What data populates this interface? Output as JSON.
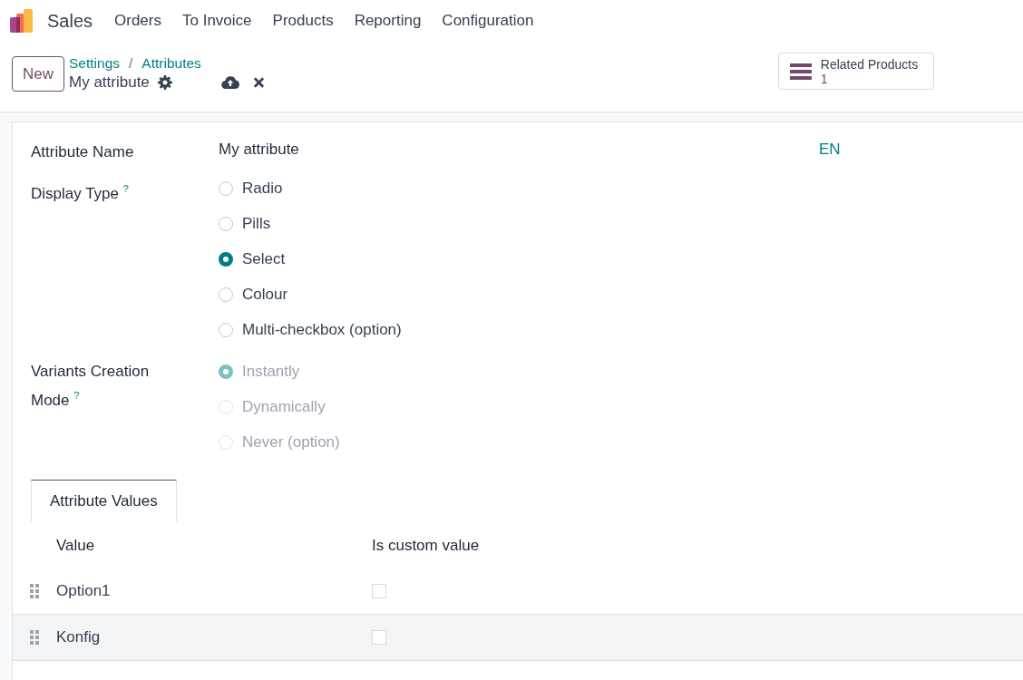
{
  "app": {
    "name": "Sales"
  },
  "menu": [
    {
      "label": "Orders"
    },
    {
      "label": "To Invoice"
    },
    {
      "label": "Products"
    },
    {
      "label": "Reporting"
    },
    {
      "label": "Configuration"
    }
  ],
  "control_panel": {
    "new_button": "New",
    "breadcrumbs": [
      {
        "label": "Settings"
      },
      {
        "label": "Attributes"
      }
    ],
    "breadcrumb_separator": "/",
    "record_title": "My attribute",
    "smart_button": {
      "label": "Related Products",
      "count": "1"
    }
  },
  "form": {
    "attribute_name": {
      "label": "Attribute Name",
      "value": "My attribute",
      "lang": "EN"
    },
    "display_type": {
      "label": "Display Type",
      "help": "?",
      "disabled": false,
      "options": [
        {
          "label": "Radio",
          "selected": false
        },
        {
          "label": "Pills",
          "selected": false
        },
        {
          "label": "Select",
          "selected": true
        },
        {
          "label": "Colour",
          "selected": false
        },
        {
          "label": "Multi-checkbox (option)",
          "selected": false
        }
      ]
    },
    "creation_mode": {
      "label": "Variants Creation Mode",
      "help": "?",
      "disabled": true,
      "options": [
        {
          "label": "Instantly",
          "selected": true
        },
        {
          "label": "Dynamically",
          "selected": false
        },
        {
          "label": "Never (option)",
          "selected": false
        }
      ]
    }
  },
  "notebook": {
    "tabs": [
      {
        "label": "Attribute Values",
        "selected": true
      }
    ],
    "columns": [
      "Value",
      "Is custom value"
    ],
    "rows": [
      {
        "value": "Option1",
        "is_custom": false,
        "highlighted": false
      },
      {
        "value": "Konfig",
        "is_custom": false,
        "highlighted": true
      }
    ]
  }
}
